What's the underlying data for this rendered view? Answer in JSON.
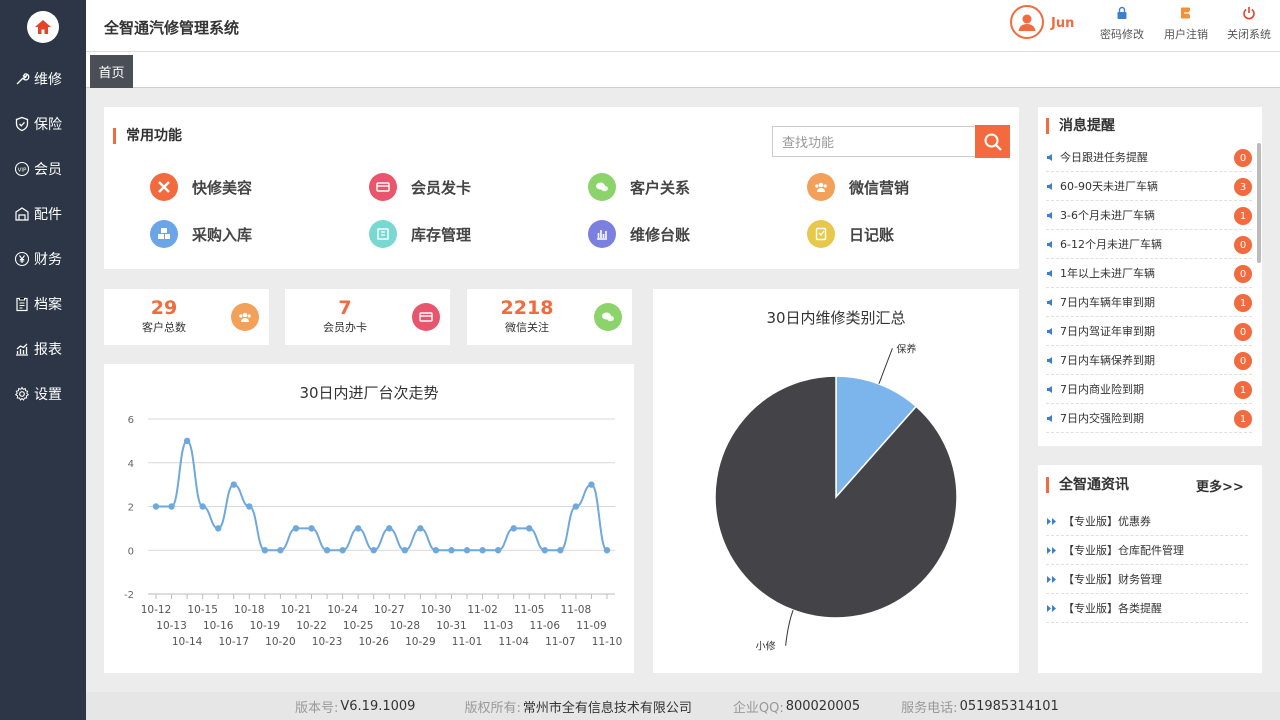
{
  "app": {
    "title": "全智通汽修管理系统",
    "username": "Jun"
  },
  "top_actions": [
    {
      "label": "密码修改",
      "icon": "lock-icon"
    },
    {
      "label": "用户注销",
      "icon": "logout-icon"
    },
    {
      "label": "关闭系统",
      "icon": "power-icon"
    }
  ],
  "sidebar": {
    "items": [
      {
        "label": "维修",
        "icon": "wrench-icon"
      },
      {
        "label": "保险",
        "icon": "shield-icon"
      },
      {
        "label": "会员",
        "icon": "vip-icon"
      },
      {
        "label": "配件",
        "icon": "parts-icon"
      },
      {
        "label": "财务",
        "icon": "yuan-icon"
      },
      {
        "label": "档案",
        "icon": "archive-icon"
      },
      {
        "label": "报表",
        "icon": "report-icon"
      },
      {
        "label": "设置",
        "icon": "gear-icon"
      }
    ]
  },
  "tabs": {
    "home": "首页"
  },
  "common": {
    "title": "常用功能",
    "search_placeholder": "查找功能",
    "functions": [
      {
        "label": "快修美容",
        "color": "#f26a3d",
        "icon": "tools-icon"
      },
      {
        "label": "会员发卡",
        "color": "#e8566d",
        "icon": "card-icon"
      },
      {
        "label": "客户关系",
        "color": "#8bd36a",
        "icon": "chat-icon"
      },
      {
        "label": "微信营销",
        "color": "#f2a05a",
        "icon": "group-icon"
      },
      {
        "label": "采购入库",
        "color": "#6aa5e8",
        "icon": "cubes-icon"
      },
      {
        "label": "库存管理",
        "color": "#7ad8d2",
        "icon": "stock-icon"
      },
      {
        "label": "维修台账",
        "color": "#7b7fe0",
        "icon": "bar-icon"
      },
      {
        "label": "日记账",
        "color": "#e8c84a",
        "icon": "notebook-icon"
      }
    ]
  },
  "stats": [
    {
      "value": "29",
      "label": "客户总数",
      "color": "#f2a05a",
      "icon": "group-icon"
    },
    {
      "value": "7",
      "label": "会员办卡",
      "color": "#e8566d",
      "icon": "card-icon"
    },
    {
      "value": "2218",
      "label": "微信关注",
      "color": "#8bd36a",
      "icon": "wechat-icon"
    }
  ],
  "line_chart": {
    "title": "30日内进厂台次走势",
    "chart_data": {
      "type": "line",
      "x": [
        "10-12",
        "10-13",
        "10-14",
        "10-15",
        "10-16",
        "10-17",
        "10-18",
        "10-19",
        "10-20",
        "10-21",
        "10-22",
        "10-23",
        "10-24",
        "10-25",
        "10-26",
        "10-27",
        "10-28",
        "10-29",
        "10-30",
        "10-31",
        "11-01",
        "11-02",
        "11-03",
        "11-04",
        "11-05",
        "11-06",
        "11-07",
        "11-08",
        "11-09",
        "11-10"
      ],
      "values": [
        2,
        2,
        5,
        2,
        1,
        3,
        2,
        0,
        0,
        1,
        1,
        0,
        0,
        1,
        0,
        1,
        0,
        1,
        0,
        0,
        0,
        0,
        0,
        1,
        1,
        0,
        0,
        2,
        3,
        0
      ],
      "yticks": [
        -2,
        0,
        2,
        4,
        6
      ],
      "ylim": [
        -2,
        6
      ],
      "color": "#6fa8dc",
      "grid": true
    }
  },
  "pie_chart": {
    "title": "30日内维修类别汇总",
    "chart_data": {
      "type": "pie",
      "slices": [
        {
          "label": "保养",
          "value": 3,
          "color": "#7cb5ec"
        },
        {
          "label": "小修",
          "value": 23,
          "color": "#434348"
        }
      ]
    }
  },
  "messages": {
    "title": "消息提醒",
    "items": [
      {
        "label": "今日跟进任务提醒",
        "count": "0"
      },
      {
        "label": "60-90天未进厂车辆",
        "count": "3"
      },
      {
        "label": "3-6个月未进厂车辆",
        "count": "1"
      },
      {
        "label": "6-12个月未进厂车辆",
        "count": "0"
      },
      {
        "label": "1年以上未进厂车辆",
        "count": "0"
      },
      {
        "label": "7日内车辆年审到期",
        "count": "1"
      },
      {
        "label": "7日内驾证年审到期",
        "count": "0"
      },
      {
        "label": "7日内车辆保养到期",
        "count": "0"
      },
      {
        "label": "7日内商业险到期",
        "count": "1"
      },
      {
        "label": "7日内交强险到期",
        "count": "1"
      }
    ]
  },
  "news": {
    "title": "全智通资讯",
    "more": "更多>>",
    "items": [
      "【专业版】优惠券",
      "【专业版】仓库配件管理",
      "【专业版】财务管理",
      "【专业版】各类提醒"
    ]
  },
  "footer": {
    "version_label": "版本号:",
    "version": "V6.19.1009",
    "copyright_label": "版权所有:",
    "copyright": "常州市全有信息技术有限公司",
    "qq_label": "企业QQ:",
    "qq": "800020005",
    "phone_label": "服务电话:",
    "phone": "051985314101"
  },
  "colors": {
    "accent": "#f26a3d",
    "sidebar": "#2c3646"
  }
}
